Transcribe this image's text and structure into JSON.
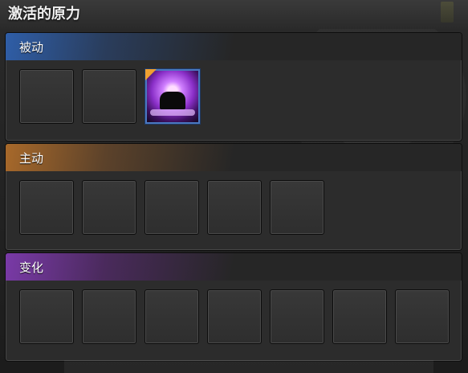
{
  "window": {
    "title": "激活的原力"
  },
  "sections": [
    {
      "label": "被动",
      "accent": "#2f5ea8",
      "slot_count": 3,
      "filled_slot_index": 2,
      "skill_icon": "purple-force-skill-icon"
    },
    {
      "label": "主动",
      "accent": "#a8692a",
      "slot_count": 5
    },
    {
      "label": "变化",
      "accent": "#7a3aa8",
      "slot_count": 7
    }
  ]
}
